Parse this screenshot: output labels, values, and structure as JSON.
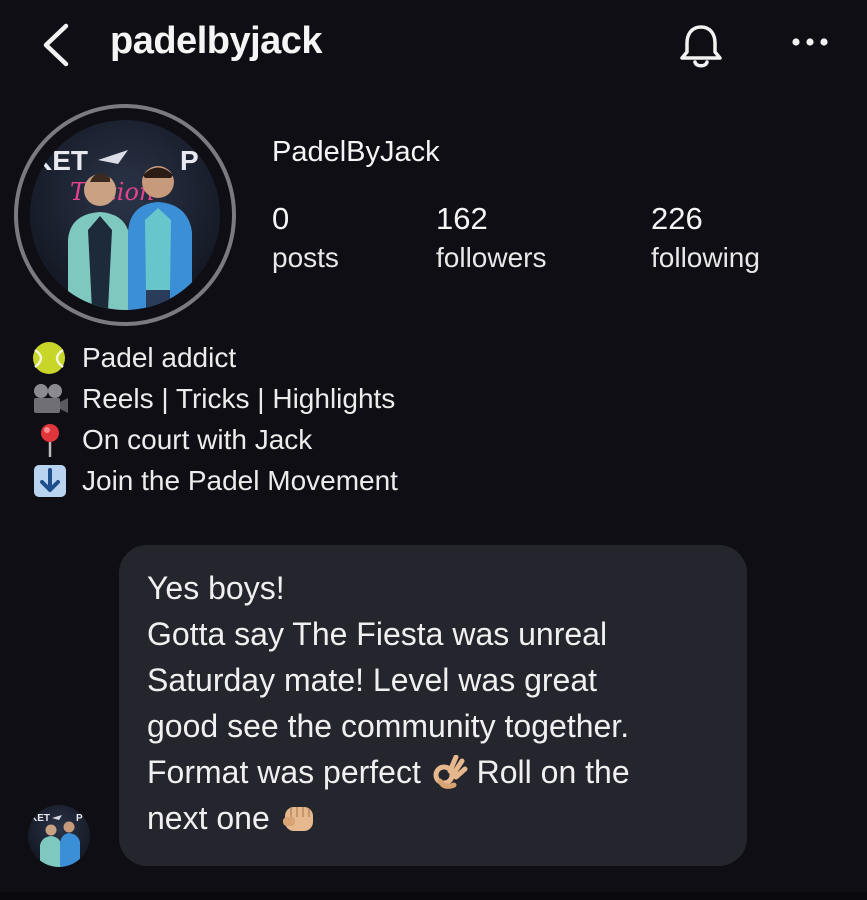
{
  "header": {
    "username": "padelbyjack",
    "back_icon": "chevron-left-icon",
    "bell_icon": "bell-icon",
    "more_icon": "more-horizontal-icon"
  },
  "profile": {
    "display_name": "PadelByJack",
    "avatar_text_top": "KET",
    "avatar_text_top_right": "P",
    "avatar_script_text": "Tiction",
    "stats": [
      {
        "value": "0",
        "label": "posts"
      },
      {
        "value": "162",
        "label": "followers"
      },
      {
        "value": "226",
        "label": "following"
      }
    ]
  },
  "bio": [
    {
      "icon": "tennis-ball-icon",
      "text": "Padel addict"
    },
    {
      "icon": "movie-camera-icon",
      "text": "Reels | Tricks | Highlights"
    },
    {
      "icon": "round-pushpin-icon",
      "text": "On court with Jack"
    },
    {
      "icon": "down-arrow-icon",
      "text": "Join the Padel Movement"
    }
  ],
  "message": {
    "lines": [
      "Yes boys!",
      "Gotta say The Fiesta was unreal",
      "Saturday mate! Level was great",
      "good see the community together.",
      "Format was perfect",
      "Roll on the",
      "next one"
    ],
    "emoji_1": "ok-hand-icon",
    "emoji_2": "fist-bump-icon"
  },
  "colors": {
    "background": "#0e0e14",
    "bubble": "#25252d",
    "text": "#f2f2f2"
  }
}
